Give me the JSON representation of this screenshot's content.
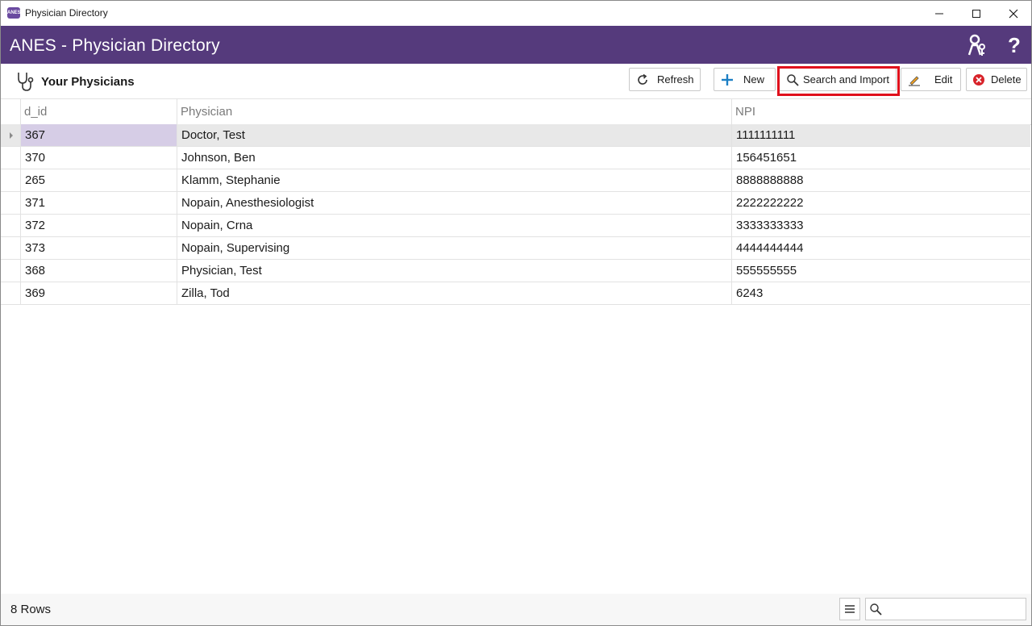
{
  "window": {
    "title": "Physician Directory",
    "app_icon_text": "ANES"
  },
  "header": {
    "title": "ANES - Physician Directory",
    "help_label": "?"
  },
  "toolbar": {
    "section_title": "Your Physicians",
    "refresh_label": "Refresh",
    "new_label": "New",
    "search_import_label": "Search and Import",
    "edit_label": "Edit",
    "delete_label": "Delete"
  },
  "grid": {
    "columns": [
      "d_id",
      "Physician",
      "NPI"
    ],
    "rows": [
      {
        "d_id": "367",
        "physician": "Doctor, Test",
        "npi": "1111111111"
      },
      {
        "d_id": "370",
        "physician": "Johnson, Ben",
        "npi": "156451651"
      },
      {
        "d_id": "265",
        "physician": "Klamm, Stephanie",
        "npi": "8888888888"
      },
      {
        "d_id": "371",
        "physician": "Nopain, Anesthesiologist",
        "npi": "2222222222"
      },
      {
        "d_id": "372",
        "physician": "Nopain, Crna",
        "npi": "3333333333"
      },
      {
        "d_id": "373",
        "physician": "Nopain, Supervising",
        "npi": "4444444444"
      },
      {
        "d_id": "368",
        "physician": "Physician, Test",
        "npi": "555555555"
      },
      {
        "d_id": "369",
        "physician": "Zilla, Tod",
        "npi": "6243"
      }
    ]
  },
  "status": {
    "row_count": "8 Rows",
    "search_value": "",
    "search_placeholder": ""
  },
  "colors": {
    "header_purple": "#553a7c",
    "selected_cell": "#d6cde6",
    "highlight_red": "#e0101c",
    "new_plus_blue": "#1c7fc4",
    "delete_red": "#d8232a"
  }
}
